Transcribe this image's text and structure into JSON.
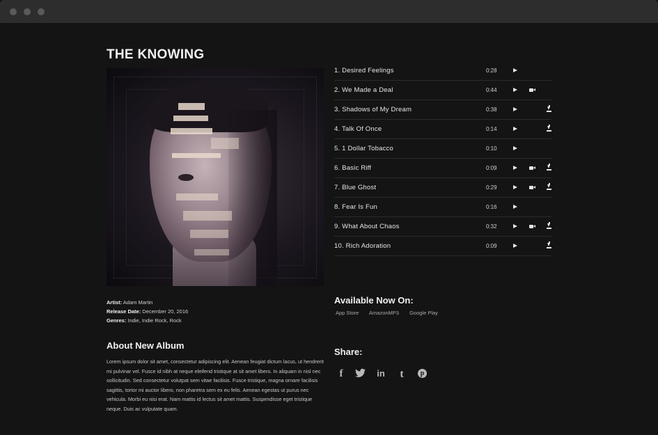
{
  "album": {
    "title": "THE KNOWING"
  },
  "tracks": [
    {
      "name": "1. Desired Feelings",
      "duration": "0:28",
      "video": false,
      "download": false
    },
    {
      "name": "2. We Made a Deal",
      "duration": "0:44",
      "video": true,
      "download": false
    },
    {
      "name": "3. Shadows of My Dream",
      "duration": "0:38",
      "video": false,
      "download": true
    },
    {
      "name": "4. Talk Of Once",
      "duration": "0:14",
      "video": false,
      "download": true
    },
    {
      "name": "5. 1 Dollar Tobacco",
      "duration": "0:10",
      "video": false,
      "download": false
    },
    {
      "name": "6. Basic Riff",
      "duration": "0:09",
      "video": true,
      "download": true
    },
    {
      "name": "7. Blue Ghost",
      "duration": "0:29",
      "video": true,
      "download": true
    },
    {
      "name": "8. Fear Is Fun",
      "duration": "0:16",
      "video": false,
      "download": false
    },
    {
      "name": "9. What About Chaos",
      "duration": "0:32",
      "video": true,
      "download": true
    },
    {
      "name": "10. Rich Adoration",
      "duration": "0:09",
      "video": false,
      "download": true
    }
  ],
  "meta": {
    "artist_label": "Artist:",
    "artist": "Adam Martin",
    "release_label": "Release Date:",
    "release": "December 20, 2016",
    "genres_label": "Genres:",
    "genres": "Indie, Indie Rock, Rock"
  },
  "about": {
    "title": "About New Album",
    "body": "Lorem ipsum dolor sit amet, consectetur adipiscing elit. Aenean feugiat dictum lacus, ut hendrerit mi pulvinar vel. Fusce id nibh at neque eleifend tristique at sit amet libero. In aliquam in nisl nec sollicitudin. Sed consectetur volutpat sem vitae facilisis. Fusce tristique, magna ornare facilisis sagittis, tortor mi auctor libero, non pharetra sem ex eu felis. Aenean egestas ut purus nec vehicula. Morbi eu nisi erat. Nam mattis id lectus sit amet mattis. Suspendisse eget tristique neque. Duis ac vulputate quam."
  },
  "available": {
    "title": "Available Now On:",
    "stores": [
      "App Store",
      "AmazonMP3",
      "Google Play"
    ]
  },
  "share": {
    "title": "Share:",
    "icons": [
      "facebook-icon",
      "twitter-icon",
      "linkedin-icon",
      "tumblr-icon",
      "pinterest-icon"
    ],
    "glyphs": {
      "facebook": "f",
      "twitter": "🐦",
      "linkedin": "in",
      "tumblr": "t",
      "pinterest": "p"
    }
  },
  "colors": {
    "background": "#141415",
    "text": "#dcdcdc",
    "divider": "#2b2b2d"
  }
}
